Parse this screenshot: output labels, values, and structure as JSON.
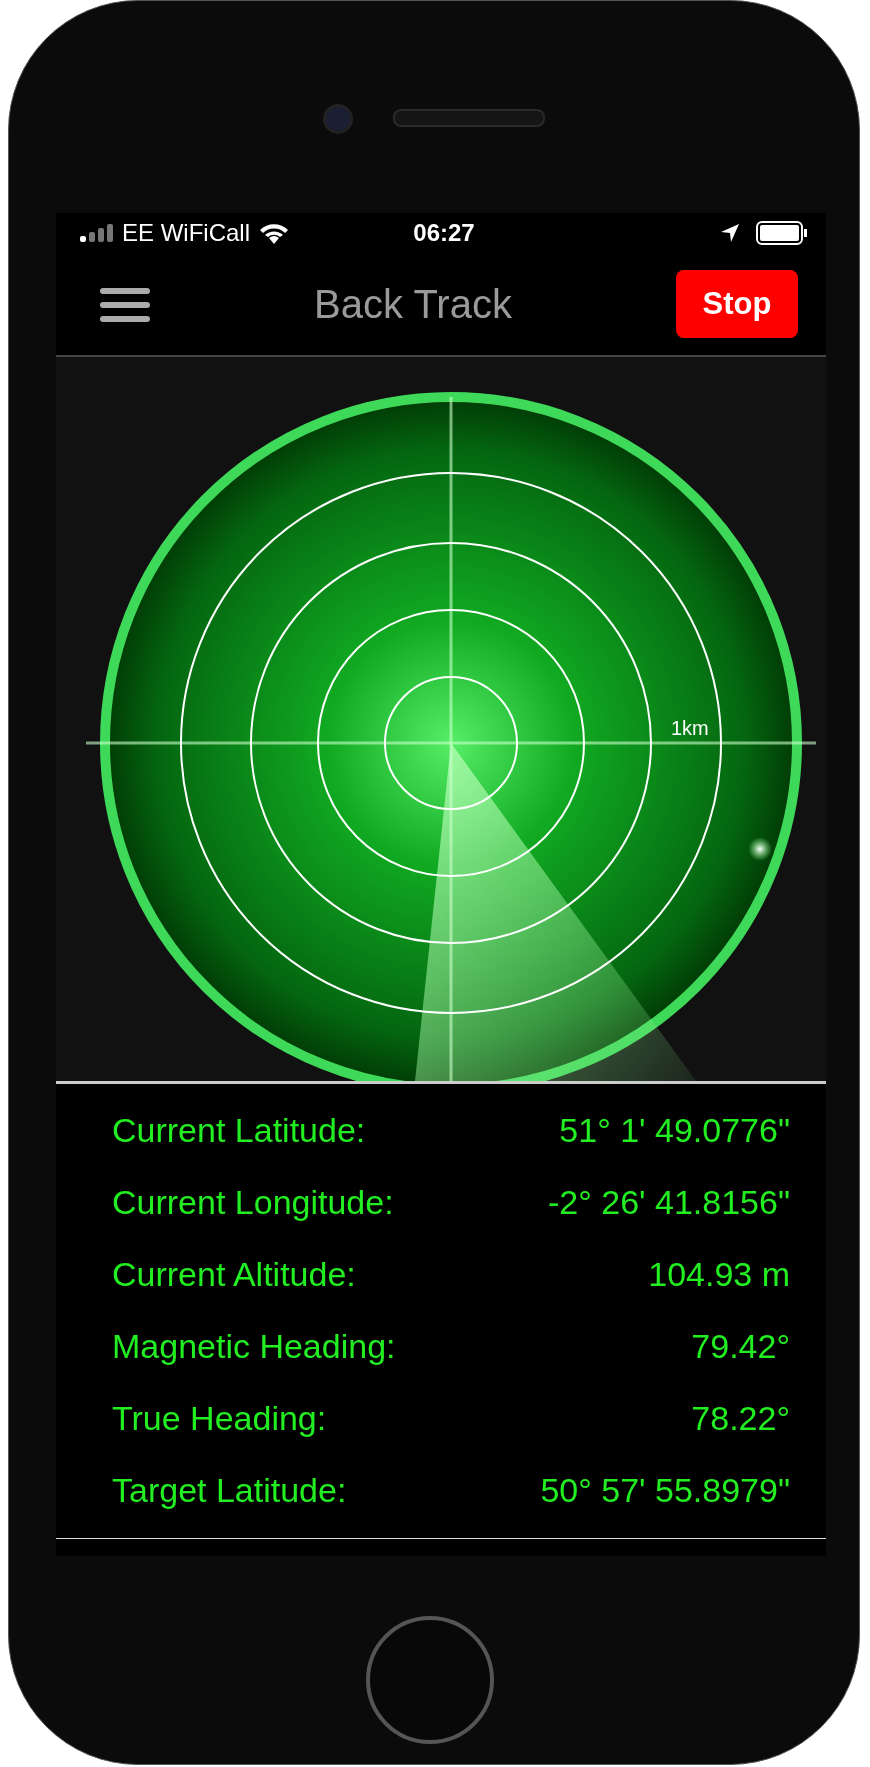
{
  "status_bar": {
    "carrier": "EE WiFiCall",
    "time": "06:27"
  },
  "header": {
    "title": "Back Track",
    "action_button": "Stop"
  },
  "radar": {
    "scale_label": "1km"
  },
  "readings": [
    {
      "label": "Current Latitude:",
      "value": "51° 1' 49.0776\""
    },
    {
      "label": "Current Longitude:",
      "value": "-2° 26' 41.8156\""
    },
    {
      "label": "Current Altitude:",
      "value": "104.93 m"
    },
    {
      "label": "Magnetic Heading:",
      "value": "79.42°"
    },
    {
      "label": "True Heading:",
      "value": "78.22°"
    },
    {
      "label": "Target Latitude:",
      "value": "50° 57' 55.8979\""
    }
  ]
}
